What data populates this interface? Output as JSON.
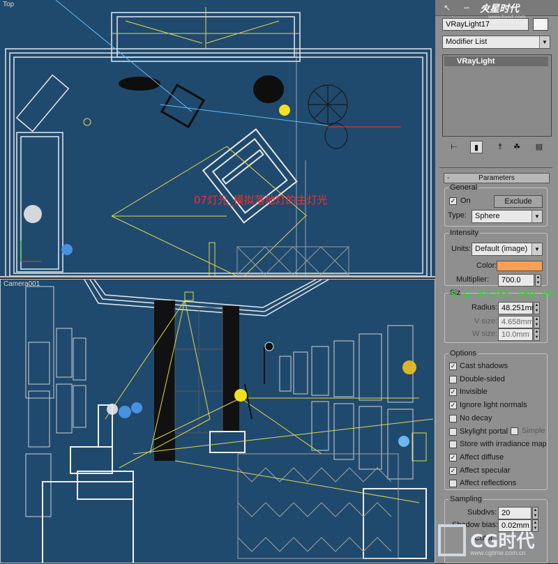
{
  "viewports": {
    "top_label": "Top",
    "camera_label": "Camera001",
    "annotation": "07灯光_模拟落地灯的主灯光"
  },
  "panel": {
    "tabs": [
      "arrow-icon",
      "curve-icon",
      "hierarchy-icon"
    ],
    "watermark": "火星时代",
    "watermark_url": "www.hxsd.com",
    "object_name": "VRayLight17",
    "modifier_list": "Modifier List",
    "stack_item": "VRayLight",
    "toolbar": [
      "pin-stack-icon",
      "show-end-result-icon",
      "make-unique-icon",
      "remove-modifier-icon",
      "configure-sets-icon"
    ],
    "rollout_title": "Parameters",
    "general": {
      "title": "General",
      "on_label": "On",
      "on_checked": true,
      "exclude_label": "Exclude",
      "type_label": "Type:",
      "type_value": "Sphere"
    },
    "intensity": {
      "title": "Intensity",
      "units_label": "Units:",
      "units_value": "Default (image)",
      "color_label": "Color:",
      "color_hex": "#ff9f54",
      "multiplier_label": "Multiplier:",
      "multiplier_value": "700.0"
    },
    "size": {
      "title_partial": "Siz",
      "radius_label": "Radius:",
      "radius_value": "48.251mm",
      "vsize_label": "V size:",
      "vsize_value": "4.658mm",
      "wsize_label": "W size:",
      "wsize_value": "10.0mm"
    },
    "rgb_annotation": "R. G. B=255. 160. 84",
    "options": {
      "title": "Options",
      "items": [
        {
          "label": "Cast shadows",
          "checked": true
        },
        {
          "label": "Double-sided",
          "checked": false
        },
        {
          "label": "Invisible",
          "checked": true
        },
        {
          "label": "Ignore light normals",
          "checked": true
        },
        {
          "label": "No decay",
          "checked": false
        },
        {
          "label": "Skylight portal",
          "checked": false
        },
        {
          "label": "Store with irradiance map",
          "checked": false
        },
        {
          "label": "Affect diffuse",
          "checked": true
        },
        {
          "label": "Affect specular",
          "checked": true
        },
        {
          "label": "Affect reflections",
          "checked": false
        }
      ],
      "simple_label": "Simple"
    },
    "sampling": {
      "title": "Sampling",
      "subdivs_label": "Subdivs:",
      "subdivs_value": "20",
      "shadow_bias_label": "Shadow bias:",
      "shadow_bias_value": "0.02mm",
      "cutoff_label_partial": "Cutof"
    },
    "logo": {
      "text": "CG时代",
      "url": "www.cgtime.com.cn"
    }
  },
  "colors": {
    "viewport_bg": "#1f4a6e",
    "panel_bg": "#8f8f8f",
    "wire_white": "#e8e8e8",
    "wire_yellow": "#e6d84a",
    "annotation_red": "#ff2a2a",
    "annotation_green": "#2bd82b"
  }
}
